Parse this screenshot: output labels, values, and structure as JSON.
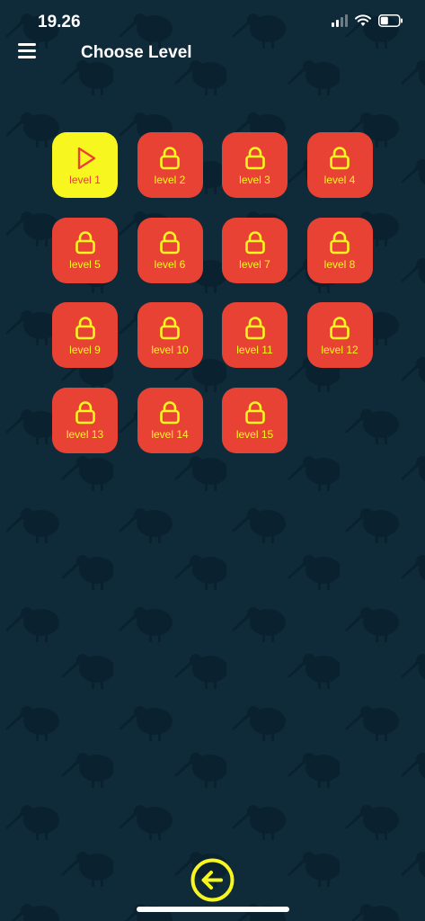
{
  "status_bar": {
    "time": "19.26"
  },
  "header": {
    "title": "Choose Level"
  },
  "levels": [
    {
      "label": "level 1",
      "state": "unlocked",
      "icon": "play-icon"
    },
    {
      "label": "level 2",
      "state": "locked",
      "icon": "lock-icon"
    },
    {
      "label": "level 3",
      "state": "locked",
      "icon": "lock-icon"
    },
    {
      "label": "level 4",
      "state": "locked",
      "icon": "lock-icon"
    },
    {
      "label": "level 5",
      "state": "locked",
      "icon": "lock-icon"
    },
    {
      "label": "level 6",
      "state": "locked",
      "icon": "lock-icon"
    },
    {
      "label": "level 7",
      "state": "locked",
      "icon": "lock-icon"
    },
    {
      "label": "level 8",
      "state": "locked",
      "icon": "lock-icon"
    },
    {
      "label": "level 9",
      "state": "locked",
      "icon": "lock-icon"
    },
    {
      "label": "level 10",
      "state": "locked",
      "icon": "lock-icon"
    },
    {
      "label": "level 11",
      "state": "locked",
      "icon": "lock-icon"
    },
    {
      "label": "level 12",
      "state": "locked",
      "icon": "lock-icon"
    },
    {
      "label": "level 13",
      "state": "locked",
      "icon": "lock-icon"
    },
    {
      "label": "level 14",
      "state": "locked",
      "icon": "lock-icon"
    },
    {
      "label": "level 15",
      "state": "locked",
      "icon": "lock-icon"
    }
  ],
  "colors": {
    "background": "#0f2b39",
    "tile_locked": "#e84235",
    "tile_unlocked": "#f7f71f",
    "accent_yellow": "#f7f71f"
  },
  "icons": {
    "menu": "hamburger-menu-icon",
    "back": "arrow-left-circle-icon",
    "background_motif": "kiwi-bird-icon"
  }
}
